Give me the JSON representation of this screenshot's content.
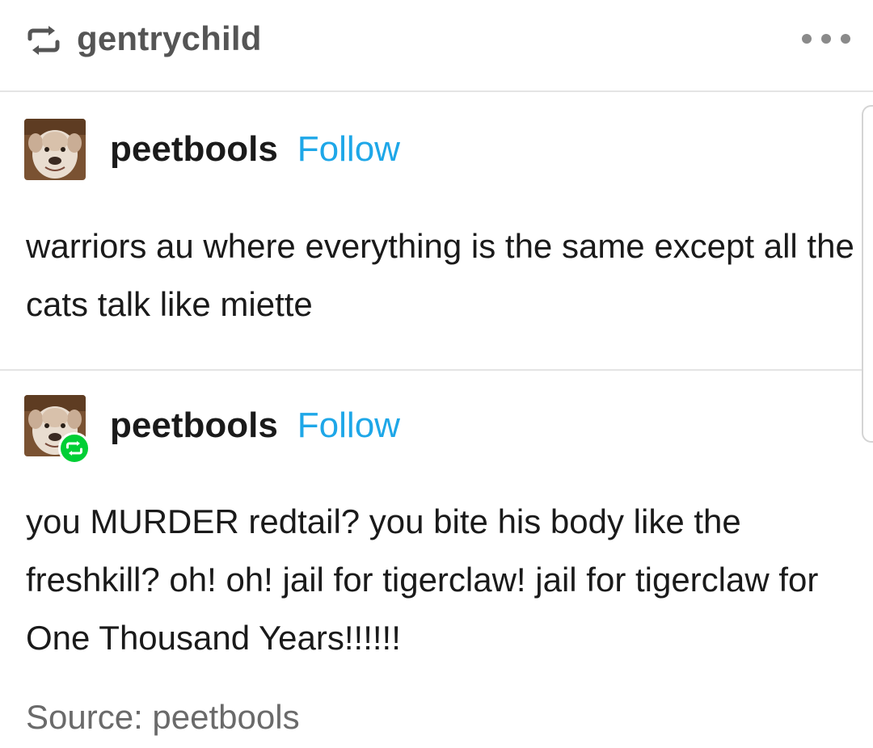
{
  "header": {
    "reblogger": "gentrychild",
    "reblog_icon": "reblog-icon",
    "more_icon": "more-dots-icon"
  },
  "posts": [
    {
      "username": "peetbools",
      "follow_label": "Follow",
      "avatar": "dog-avatar",
      "body": "warriors au where everything is the same except all the cats talk like miette"
    },
    {
      "username": "peetbools",
      "follow_label": "Follow",
      "avatar": "dog-avatar",
      "badge": "reblog-badge-icon",
      "body": "you MURDER redtail? you bite his body like the freshkill? oh! oh! jail for tigerclaw! jail for tigerclaw for One Thousand Years!!!!!!"
    }
  ],
  "source": {
    "label": "Source: peetbools"
  },
  "colors": {
    "follow": "#1ea7e8",
    "reblog_badge": "#00cf35",
    "header_text": "#555555",
    "divider": "#e4e4e4"
  }
}
